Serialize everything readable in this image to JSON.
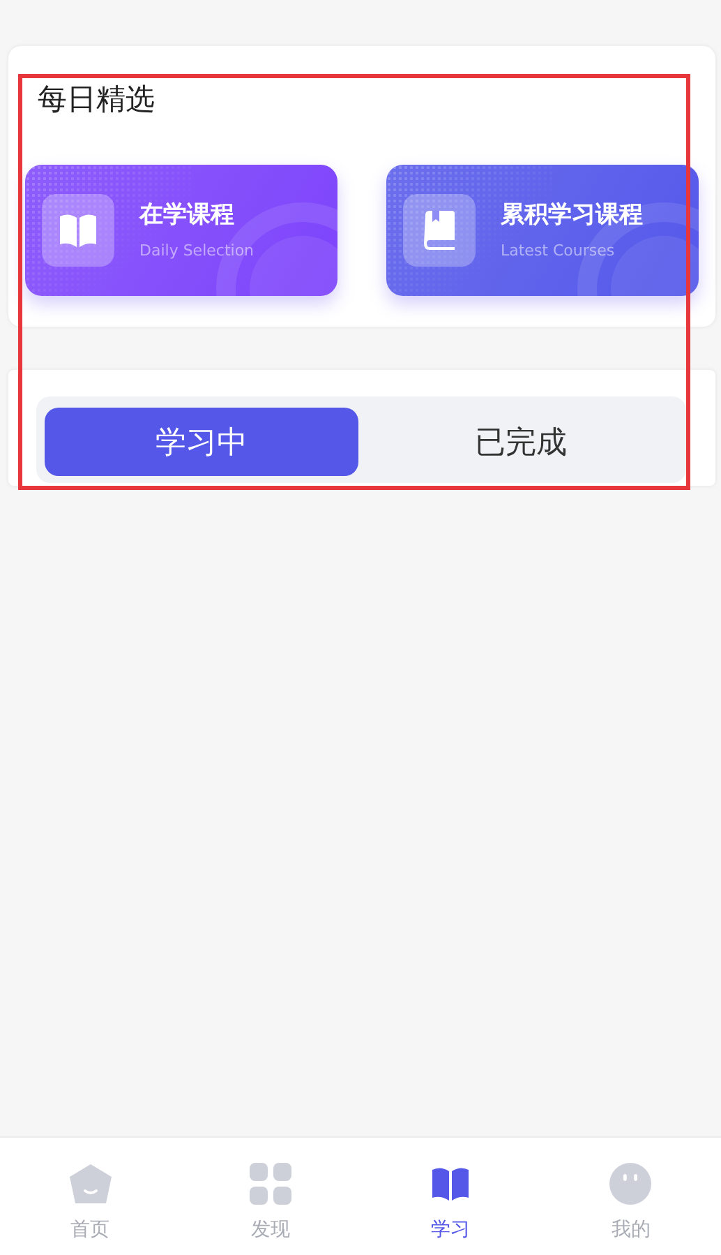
{
  "daily_section": {
    "title": "每日精选",
    "cards": [
      {
        "title": "在学课程",
        "subtitle": "Daily Selection",
        "color": "#7d44fb"
      },
      {
        "title": "累积学习课程",
        "subtitle": "Latest Courses",
        "color": "#5558ea"
      }
    ]
  },
  "segments": [
    {
      "label": "学习中",
      "selected": true
    },
    {
      "label": "已完成",
      "selected": false
    }
  ],
  "tab_bar": [
    {
      "label": "首页",
      "selected": false
    },
    {
      "label": "发现",
      "selected": false
    },
    {
      "label": "学习",
      "selected": true
    },
    {
      "label": "我的",
      "selected": false
    }
  ]
}
